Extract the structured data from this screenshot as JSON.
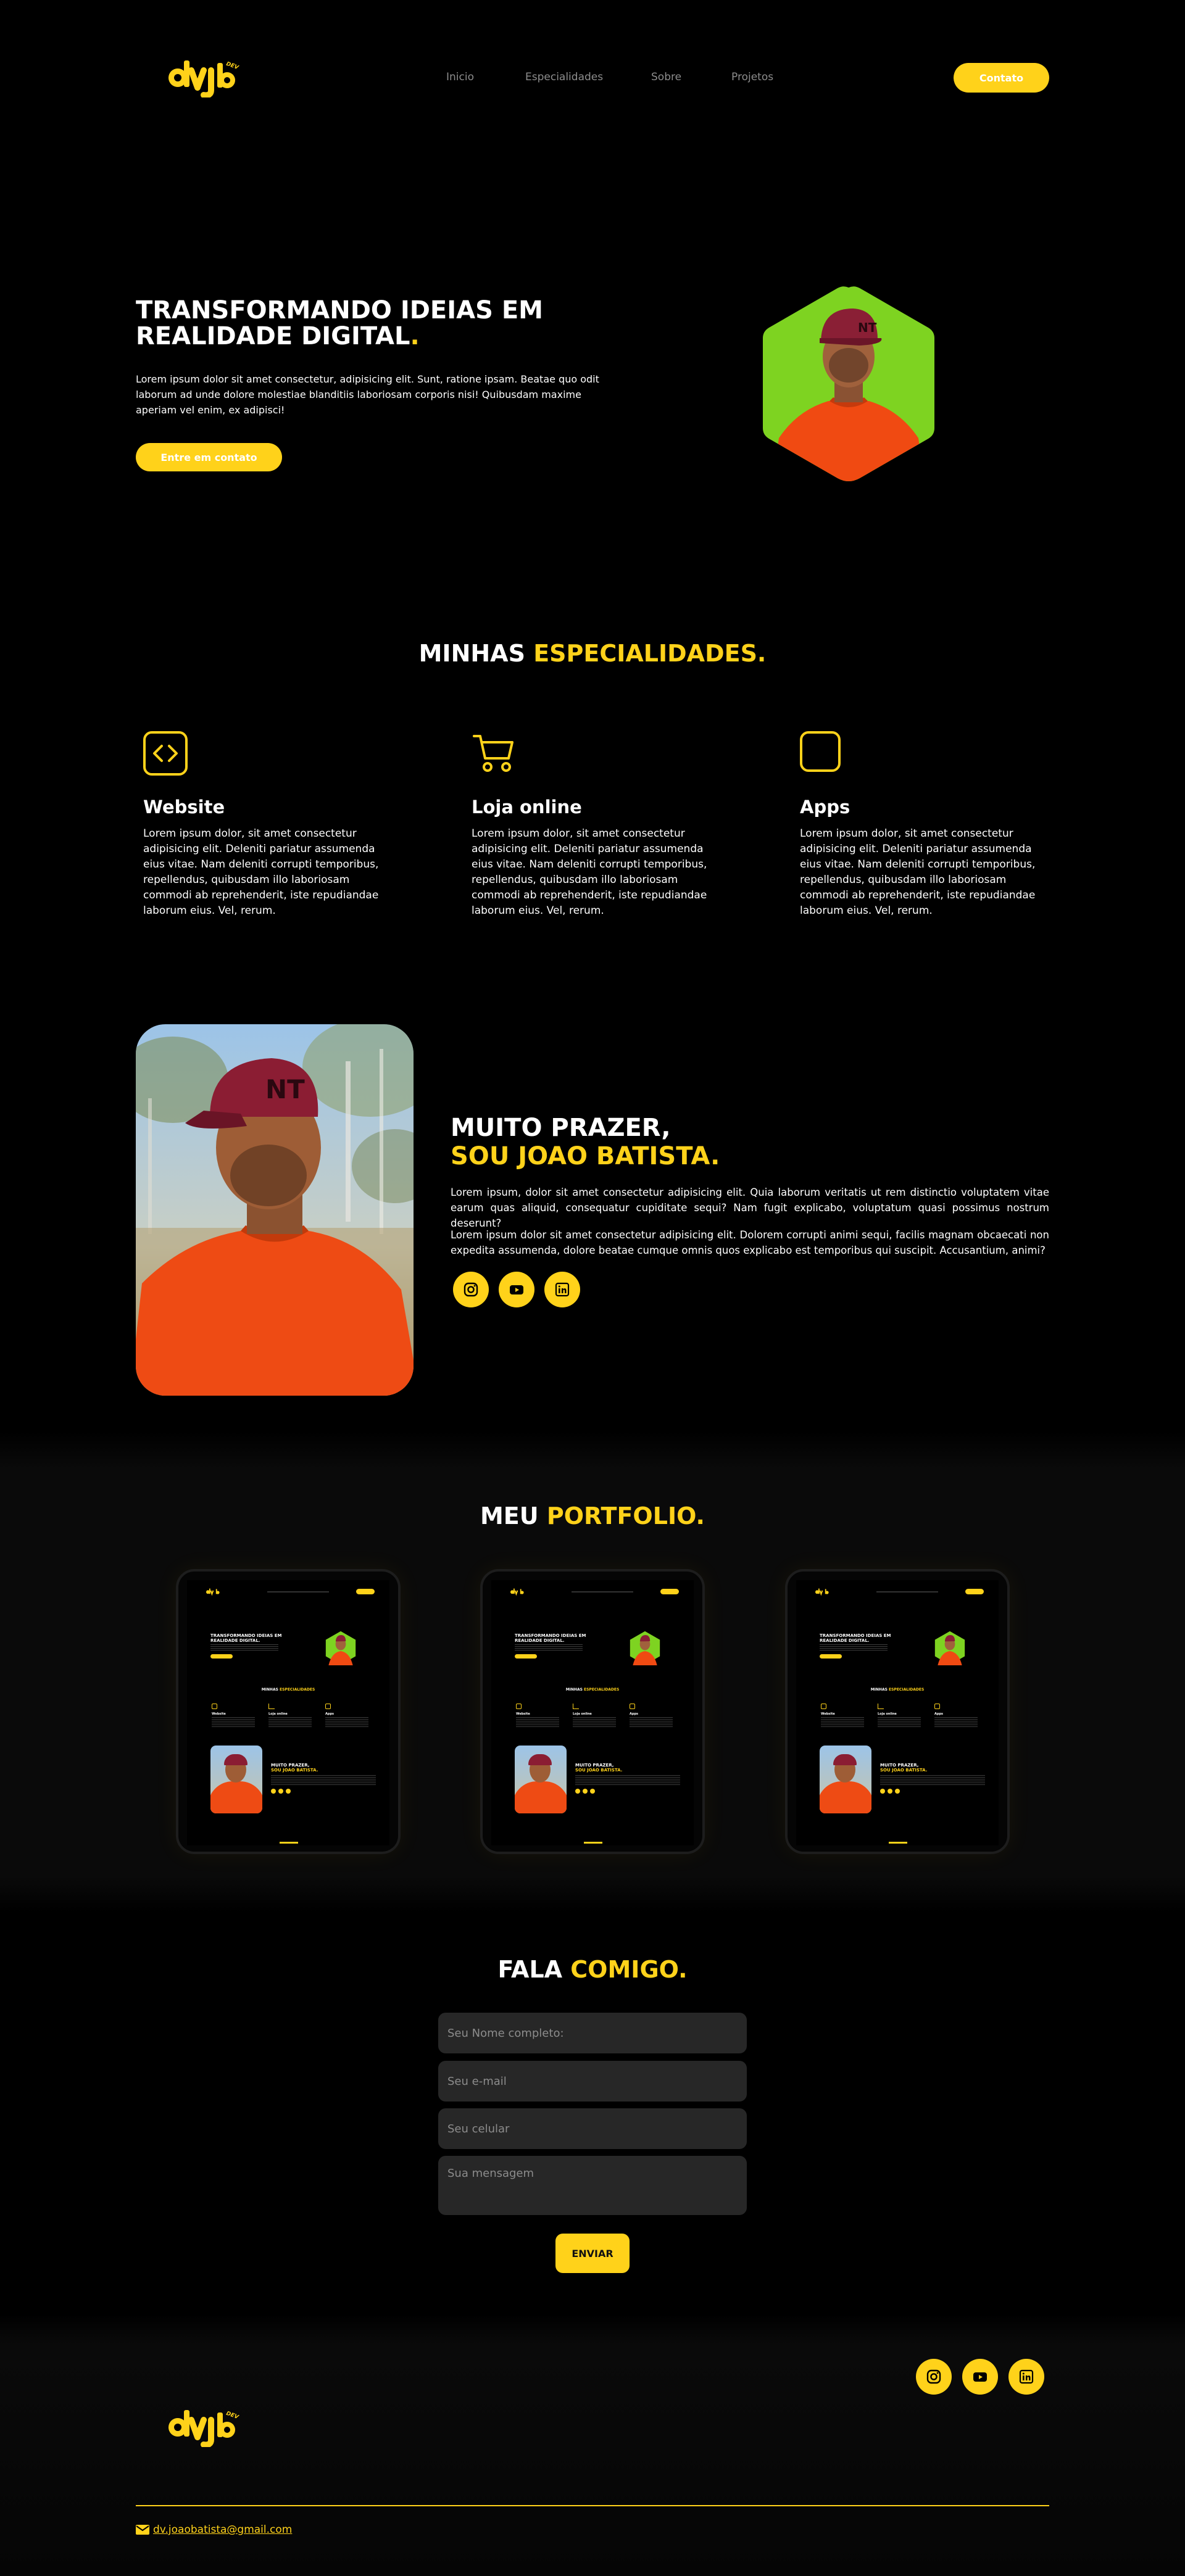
{
  "brand": {
    "logo_text": "dvjb",
    "logo_sub": "DEV"
  },
  "nav": {
    "items": [
      {
        "label": "Inicio"
      },
      {
        "label": "Especialidades"
      },
      {
        "label": "Sobre"
      },
      {
        "label": "Projetos"
      }
    ],
    "cta_label": "Contato"
  },
  "hero": {
    "title_line1": "TRANSFORMANDO IDEIAS EM",
    "title_line2": "REALIDADE DIGITAL",
    "title_dot": ".",
    "text": "Lorem ipsum dolor sit amet consectetur, adipisicing elit. Sunt, ratione ipsam. Beatae quo odit laborum ad unde dolore molestiae blanditiis laboriosam corporis nisi! Quibusdam maxime aperiam vel enim, ex adipisci!",
    "button_label": "Entre em contato"
  },
  "specialties": {
    "title_plain": "MINHAS ",
    "title_accent": "ESPECIALIDADES.",
    "items": [
      {
        "icon": "code-icon",
        "title": "Website",
        "text": "Lorem ipsum dolor, sit amet consectetur adipisicing elit. Deleniti pariatur assumenda eius vitae. Nam deleniti corrupti temporibus, repellendus, quibusdam illo laboriosam commodi ab reprehenderit, iste repudiandae laborum eius. Vel, rerum."
      },
      {
        "icon": "cart-icon",
        "title": "Loja online",
        "text": "Lorem ipsum dolor, sit amet consectetur adipisicing elit. Deleniti pariatur assumenda eius vitae. Nam deleniti corrupti temporibus, repellendus, quibusdam illo laboriosam commodi ab reprehenderit, iste repudiandae laborum eius. Vel, rerum."
      },
      {
        "icon": "app-icon",
        "title": "Apps",
        "text": "Lorem ipsum dolor, sit amet consectetur adipisicing elit. Deleniti pariatur assumenda eius vitae. Nam deleniti corrupti temporibus, repellendus, quibusdam illo laboriosam commodi ab reprehenderit, iste repudiandae laborum eius. Vel, rerum."
      }
    ]
  },
  "about": {
    "title_line1": "MUITO PRAZER,",
    "title_line2": "SOU JOAO BATISTA.",
    "p1": "Lorem ipsum, dolor sit amet consectetur adipisicing elit. Quia laborum veritatis ut rem distinctio voluptatem vitae earum quas aliquid, consequatur cupiditate sequi? Nam fugit explicabo, voluptatum quasi possimus nostrum deserunt?",
    "p2": "Lorem ipsum dolor sit amet consectetur adipisicing elit. Dolorem corrupti animi sequi, facilis magnam obcaecati non expedita assumenda, dolore beatae cumque omnis quos explicabo est temporibus qui suscipit. Accusantium, animi?",
    "social": [
      "instagram-icon",
      "youtube-icon",
      "linkedin-icon"
    ]
  },
  "portfolio": {
    "title_plain": "MEU ",
    "title_accent": "PORTFOLIO.",
    "mini": {
      "title": "TRANSFORMANDO IDEIAS EM REALIDADE DIGITAL.",
      "spec_plain": "MINHAS ",
      "spec_accent": "ESPECIALIDADES",
      "cols": [
        "Website",
        "Loja online",
        "Apps"
      ],
      "about1": "MUITO PRAZER,",
      "about2": "SOU JOAO BATISTA."
    }
  },
  "contact": {
    "title_plain": "FALA ",
    "title_accent": "COMIGO.",
    "name_placeholder": "Seu Nome completo:",
    "email_placeholder": "Seu e-mail",
    "phone_placeholder": "Seu celular",
    "message_placeholder": "Sua mensagem",
    "submit_label": "ENVIAR"
  },
  "footer": {
    "social": [
      "instagram-icon",
      "youtube-icon",
      "linkedin-icon"
    ],
    "email": "dv.joaobatista@gmail.com"
  },
  "colors": {
    "accent": "#ffd21a",
    "hex_bg": "#7ed321",
    "shirt": "#f04a12",
    "background": "#000000"
  }
}
